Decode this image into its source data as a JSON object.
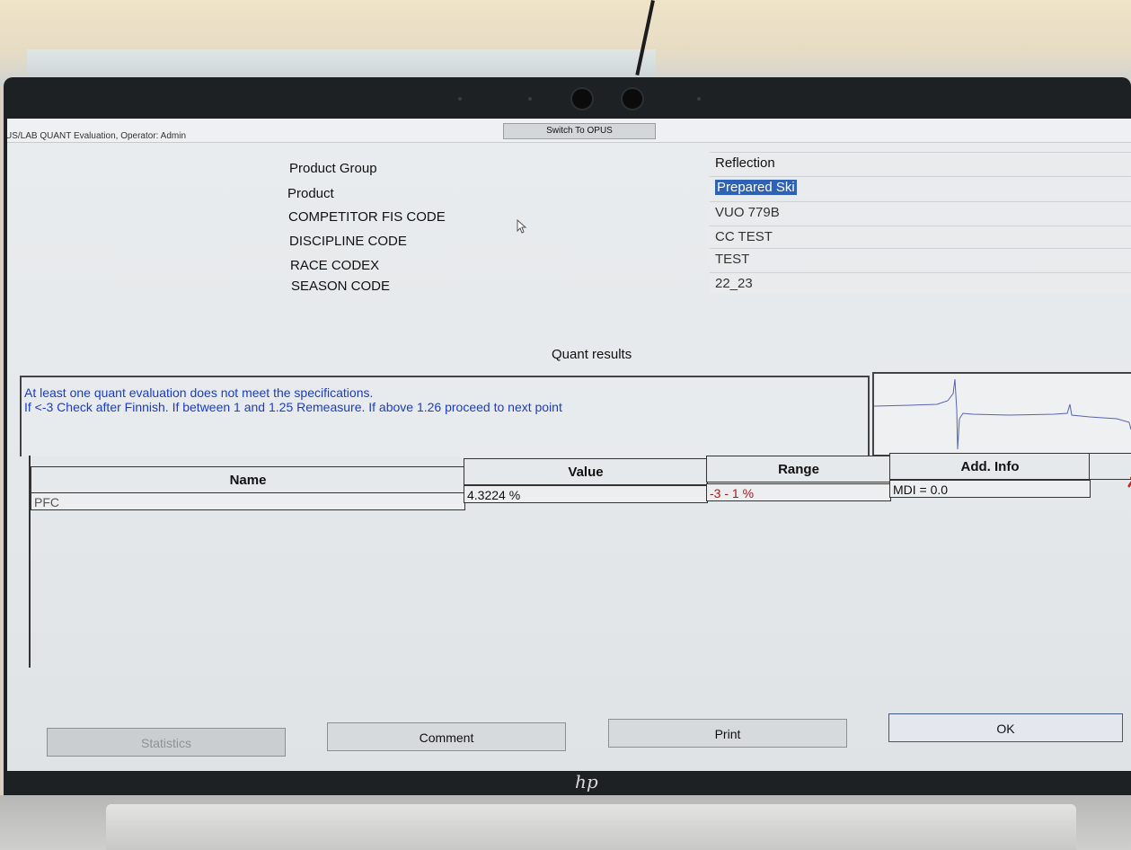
{
  "window": {
    "title": "US/LAB QUANT Evaluation, Operator: Admin",
    "switch_button": "Switch To OPUS"
  },
  "form": {
    "fields": [
      {
        "label": "Product Group",
        "value": "Reflection"
      },
      {
        "label": "Product",
        "value": "Prepared Ski",
        "selected": true
      },
      {
        "label": "COMPETITOR FIS CODE",
        "value": "VUO 779B"
      },
      {
        "label": "DISCIPLINE CODE",
        "value": "CC TEST"
      },
      {
        "label": "RACE CODEX",
        "value": "TEST"
      },
      {
        "label": "SEASON CODE",
        "value": "22_23"
      }
    ]
  },
  "quant": {
    "title": "Quant results",
    "message_line1": "At least one quant evaluation does not meet the specifications.",
    "message_line2": "If <-3 Check after Finnish. If between 1 and 1.25 Remeasure. If above 1.26 proceed to next point",
    "message_color": "#1a3bd0"
  },
  "table": {
    "headers": {
      "name": "Name",
      "value": "Value",
      "range": "Range",
      "add_info": "Add. Info"
    },
    "rows": [
      {
        "name": "PFC",
        "value": "4.3224 %",
        "range": "-3 - 1 %",
        "add_info": "MDI = 0.0",
        "status_icon": "fail-x-icon"
      }
    ]
  },
  "buttons": {
    "statistics": "Statistics",
    "comment": "Comment",
    "print": "Print",
    "ok": "OK"
  },
  "brand": {
    "logo": "hp"
  },
  "colors": {
    "selection": "#2f62b4",
    "range_out_of_spec": "#b01818",
    "fail_icon": "#c0241b"
  }
}
